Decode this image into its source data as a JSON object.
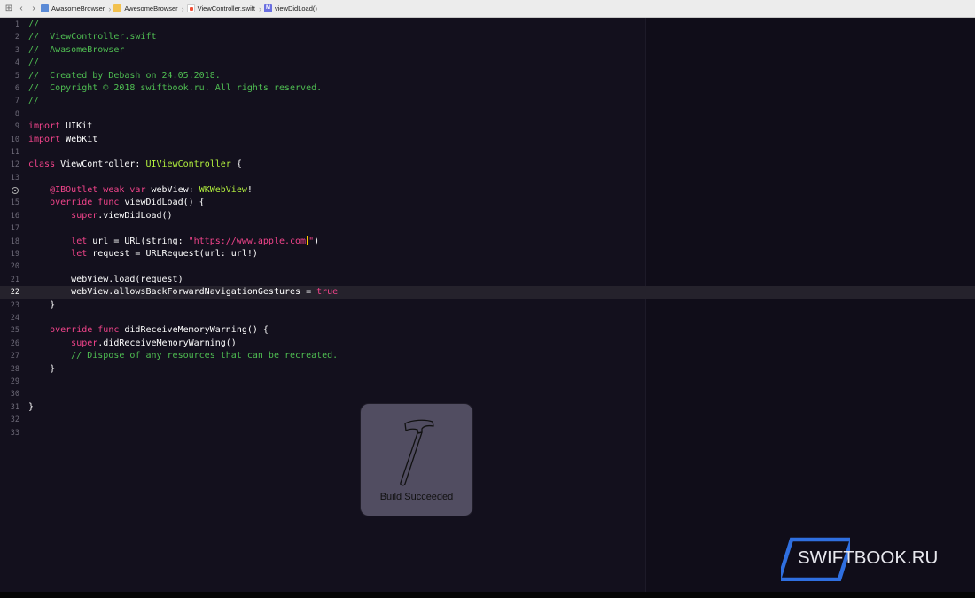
{
  "jump_bar": {
    "crumbs": [
      {
        "label": "AwasomeBrowser",
        "icon": "project-icon"
      },
      {
        "label": "AwesomeBrowser",
        "icon": "folder-icon"
      },
      {
        "label": "ViewController.swift",
        "icon": "swift-file-icon"
      },
      {
        "label": "viewDidLoad()",
        "icon": "method-icon",
        "badge": "M"
      }
    ]
  },
  "editor": {
    "current_line": 22,
    "breakpoint_line": 14,
    "colors": {
      "background": "#13101d",
      "comment": "#4fbe52",
      "keyword": "#f2448b",
      "type": "#b4f23e",
      "plain": "#ffffff",
      "line_number": "#6c6977"
    },
    "lines": [
      {
        "n": "1",
        "tokens": [
          {
            "t": "//",
            "c": "comment"
          }
        ]
      },
      {
        "n": "2",
        "tokens": [
          {
            "t": "//  ViewController.swift",
            "c": "comment"
          }
        ]
      },
      {
        "n": "3",
        "tokens": [
          {
            "t": "//  AwasomeBrowser",
            "c": "comment"
          }
        ]
      },
      {
        "n": "4",
        "tokens": [
          {
            "t": "//",
            "c": "comment"
          }
        ]
      },
      {
        "n": "5",
        "tokens": [
          {
            "t": "//  Created by Debash on 24.05.2018.",
            "c": "comment"
          }
        ]
      },
      {
        "n": "6",
        "tokens": [
          {
            "t": "//  Copyright © 2018 swiftbook.ru. All rights reserved.",
            "c": "comment"
          }
        ]
      },
      {
        "n": "7",
        "tokens": [
          {
            "t": "//",
            "c": "comment"
          }
        ]
      },
      {
        "n": "8",
        "tokens": []
      },
      {
        "n": "9",
        "tokens": [
          {
            "t": "import",
            "c": "kw"
          },
          {
            "t": " UIKit",
            "c": "plain"
          }
        ]
      },
      {
        "n": "10",
        "tokens": [
          {
            "t": "import",
            "c": "kw"
          },
          {
            "t": " WebKit",
            "c": "plain"
          }
        ]
      },
      {
        "n": "11",
        "tokens": []
      },
      {
        "n": "12",
        "tokens": [
          {
            "t": "class",
            "c": "kw"
          },
          {
            "t": " ViewController: ",
            "c": "plain"
          },
          {
            "t": "UIViewController",
            "c": "type"
          },
          {
            "t": " {",
            "c": "plain"
          }
        ]
      },
      {
        "n": "13",
        "tokens": []
      },
      {
        "n": "",
        "breakpoint": true,
        "tokens": [
          {
            "t": "    ",
            "c": "plain"
          },
          {
            "t": "@IBOutlet weak var",
            "c": "kw"
          },
          {
            "t": " webView: ",
            "c": "plain"
          },
          {
            "t": "WKWebView",
            "c": "type"
          },
          {
            "t": "!",
            "c": "plain"
          }
        ]
      },
      {
        "n": "15",
        "tokens": [
          {
            "t": "    ",
            "c": "plain"
          },
          {
            "t": "override func",
            "c": "kw"
          },
          {
            "t": " viewDidLoad() {",
            "c": "plain"
          }
        ]
      },
      {
        "n": "16",
        "tokens": [
          {
            "t": "        ",
            "c": "plain"
          },
          {
            "t": "super",
            "c": "kw"
          },
          {
            "t": ".viewDidLoad()",
            "c": "plain"
          }
        ]
      },
      {
        "n": "17",
        "tokens": []
      },
      {
        "n": "18",
        "tokens": [
          {
            "t": "        ",
            "c": "plain"
          },
          {
            "t": "let",
            "c": "kw"
          },
          {
            "t": " url = URL(string: ",
            "c": "plain"
          },
          {
            "t": "\"https://www.apple.com",
            "c": "str"
          },
          {
            "t": "",
            "c": "cursor"
          },
          {
            "t": "\"",
            "c": "str"
          },
          {
            "t": ")",
            "c": "plain"
          }
        ]
      },
      {
        "n": "19",
        "tokens": [
          {
            "t": "        ",
            "c": "plain"
          },
          {
            "t": "let",
            "c": "kw"
          },
          {
            "t": " request = URLRequest(url: url!)",
            "c": "plain"
          }
        ]
      },
      {
        "n": "20",
        "tokens": []
      },
      {
        "n": "21",
        "tokens": [
          {
            "t": "        webView.load(request)",
            "c": "plain"
          }
        ]
      },
      {
        "n": "22",
        "tokens": [
          {
            "t": "        webView.allowsBackForwardNavigationGestures = ",
            "c": "plain"
          },
          {
            "t": "true",
            "c": "kw"
          }
        ]
      },
      {
        "n": "23",
        "tokens": [
          {
            "t": "    }",
            "c": "plain"
          }
        ]
      },
      {
        "n": "24",
        "tokens": []
      },
      {
        "n": "25",
        "tokens": [
          {
            "t": "    ",
            "c": "plain"
          },
          {
            "t": "override func",
            "c": "kw"
          },
          {
            "t": " didReceiveMemoryWarning() {",
            "c": "plain"
          }
        ]
      },
      {
        "n": "26",
        "tokens": [
          {
            "t": "        ",
            "c": "plain"
          },
          {
            "t": "super",
            "c": "kw"
          },
          {
            "t": ".didReceiveMemoryWarning()",
            "c": "plain"
          }
        ]
      },
      {
        "n": "27",
        "tokens": [
          {
            "t": "        // Dispose of any resources that can be recreated.",
            "c": "comment"
          }
        ]
      },
      {
        "n": "28",
        "tokens": [
          {
            "t": "    }",
            "c": "plain"
          }
        ]
      },
      {
        "n": "29",
        "tokens": []
      },
      {
        "n": "30",
        "tokens": []
      },
      {
        "n": "31",
        "tokens": [
          {
            "t": "}",
            "c": "plain"
          }
        ]
      },
      {
        "n": "32",
        "tokens": []
      },
      {
        "n": "33",
        "tokens": []
      }
    ]
  },
  "build_hud": {
    "label": "Build Succeeded",
    "icon": "hammer-icon"
  },
  "watermark": {
    "text": "SWIFTBOOK.RU",
    "accent": "#2f6fe0"
  }
}
